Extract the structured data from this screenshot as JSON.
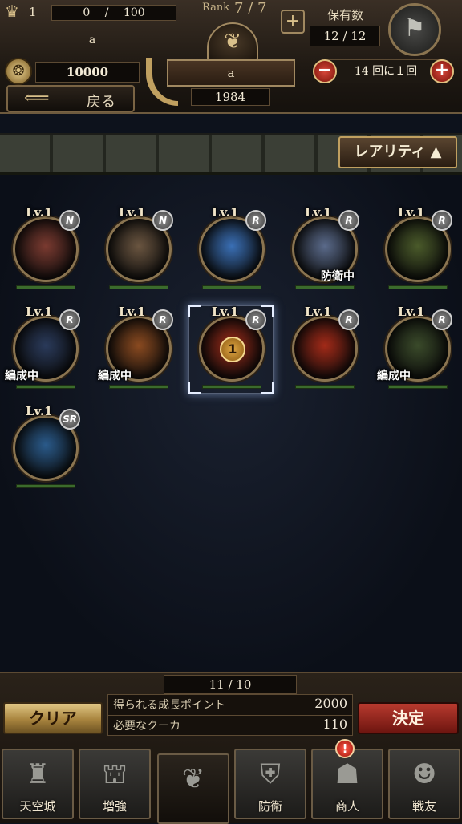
{
  "header": {
    "player_level": "1",
    "exp_current": "0",
    "exp_separator": "/",
    "exp_max": "100",
    "player_name": "a",
    "rank_label": "Rank",
    "rank_value": "7 / 7",
    "owned_label": "保有数",
    "owned_value": "12 / 12",
    "coin_value": "10000",
    "back_label": "戻る",
    "center_name": "a",
    "center_value": "1984",
    "frequency_label": "14 回に１回",
    "minus": "−",
    "plus": "+"
  },
  "sort": {
    "label": "レアリティ ▲"
  },
  "units": [
    {
      "level": "Lv.1",
      "rarity": "N",
      "status": "",
      "color": "#7a3a30"
    },
    {
      "level": "Lv.1",
      "rarity": "N",
      "status": "",
      "color": "#6a5540"
    },
    {
      "level": "Lv.1",
      "rarity": "R",
      "status": "",
      "color": "#3a6fb5"
    },
    {
      "level": "Lv.1",
      "rarity": "R",
      "status": "防衛中",
      "color": "#5a6a8a"
    },
    {
      "level": "Lv.1",
      "rarity": "R",
      "status": "",
      "color": "#4a5a2a"
    },
    {
      "level": "Lv.1",
      "rarity": "R",
      "status": "編成中",
      "color": "#2a3a5a"
    },
    {
      "level": "Lv.1",
      "rarity": "R",
      "status": "編成中",
      "color": "#8a4a20"
    },
    {
      "level": "Lv.1",
      "rarity": "R",
      "status": "",
      "color": "#9a2a18",
      "selected": "1"
    },
    {
      "level": "Lv.1",
      "rarity": "R",
      "status": "",
      "color": "#a22a18"
    },
    {
      "level": "Lv.1",
      "rarity": "R",
      "status": "編成中",
      "color": "#3a4a2a"
    },
    {
      "level": "Lv.1",
      "rarity": "SR",
      "status": "",
      "color": "#2a5a8a"
    }
  ],
  "footer": {
    "count": "11 / 10",
    "clear_label": "クリア",
    "decide_label": "決定",
    "growth_label": "得られる成長ポイント",
    "growth_value": "2000",
    "cost_label": "必要なクーカ",
    "cost_value": "110",
    "alert": "!"
  },
  "nav": [
    {
      "label": "天空城",
      "icon": "castle-icon"
    },
    {
      "label": "増強",
      "icon": "cauldron-icon"
    },
    {
      "label": "",
      "icon": "dragon-icon"
    },
    {
      "label": "防衛",
      "icon": "shield-icon"
    },
    {
      "label": "商人",
      "icon": "merchant-icon"
    },
    {
      "label": "戦友",
      "icon": "friends-icon"
    }
  ]
}
